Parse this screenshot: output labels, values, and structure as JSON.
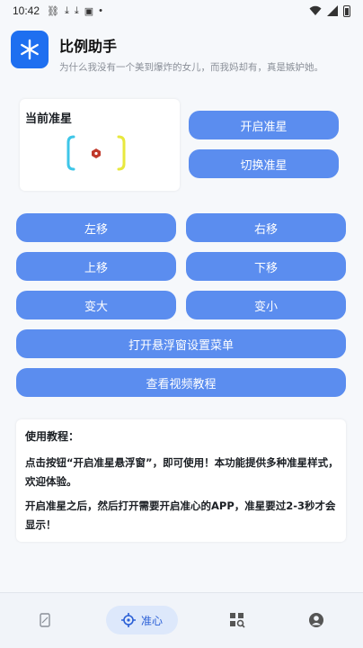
{
  "status_bar": {
    "time": "10:42",
    "icons": [
      "link-icon",
      "download-icon",
      "download-icon",
      "box-icon",
      "dot-icon"
    ],
    "right_icons": [
      "wifi-icon",
      "signal-icon",
      "battery-icon"
    ]
  },
  "app": {
    "title": "比例助手",
    "subtitle": "为什么我没有一个美到爆炸的女儿，而我妈却有，真是嫉妒她。",
    "logo_icon": "asterisk-icon",
    "brand_color": "#1e6ff0"
  },
  "crosshair_card": {
    "label": "当前准星",
    "preview_icon": "crosshair-icon"
  },
  "buttons": {
    "enable_crosshair": "开启准星",
    "switch_crosshair": "切换准星",
    "move_left": "左移",
    "move_right": "右移",
    "move_up": "上移",
    "move_down": "下移",
    "enlarge": "变大",
    "shrink": "变小",
    "open_float_menu": "打开悬浮窗设置菜单",
    "video_tutorial": "查看视频教程",
    "button_color": "#5b8def"
  },
  "tutorial": {
    "title": "使用教程：",
    "paragraph_1": "点击按钮“开启准星悬浮窗”，即可使用！本功能提供多种准星样式，欢迎体验。",
    "paragraph_2": "开启准星之后，然后打开需要开启准心的APP，准星要过2-3秒才会显示！"
  },
  "bottom_nav": {
    "items": [
      {
        "icon": "phone-ratio-icon",
        "label": ""
      },
      {
        "icon": "crosshair-target-icon",
        "label": "准心",
        "active": true
      },
      {
        "icon": "grid-search-icon",
        "label": ""
      },
      {
        "icon": "profile-icon",
        "label": ""
      }
    ],
    "active_color": "#2a5fd6"
  }
}
